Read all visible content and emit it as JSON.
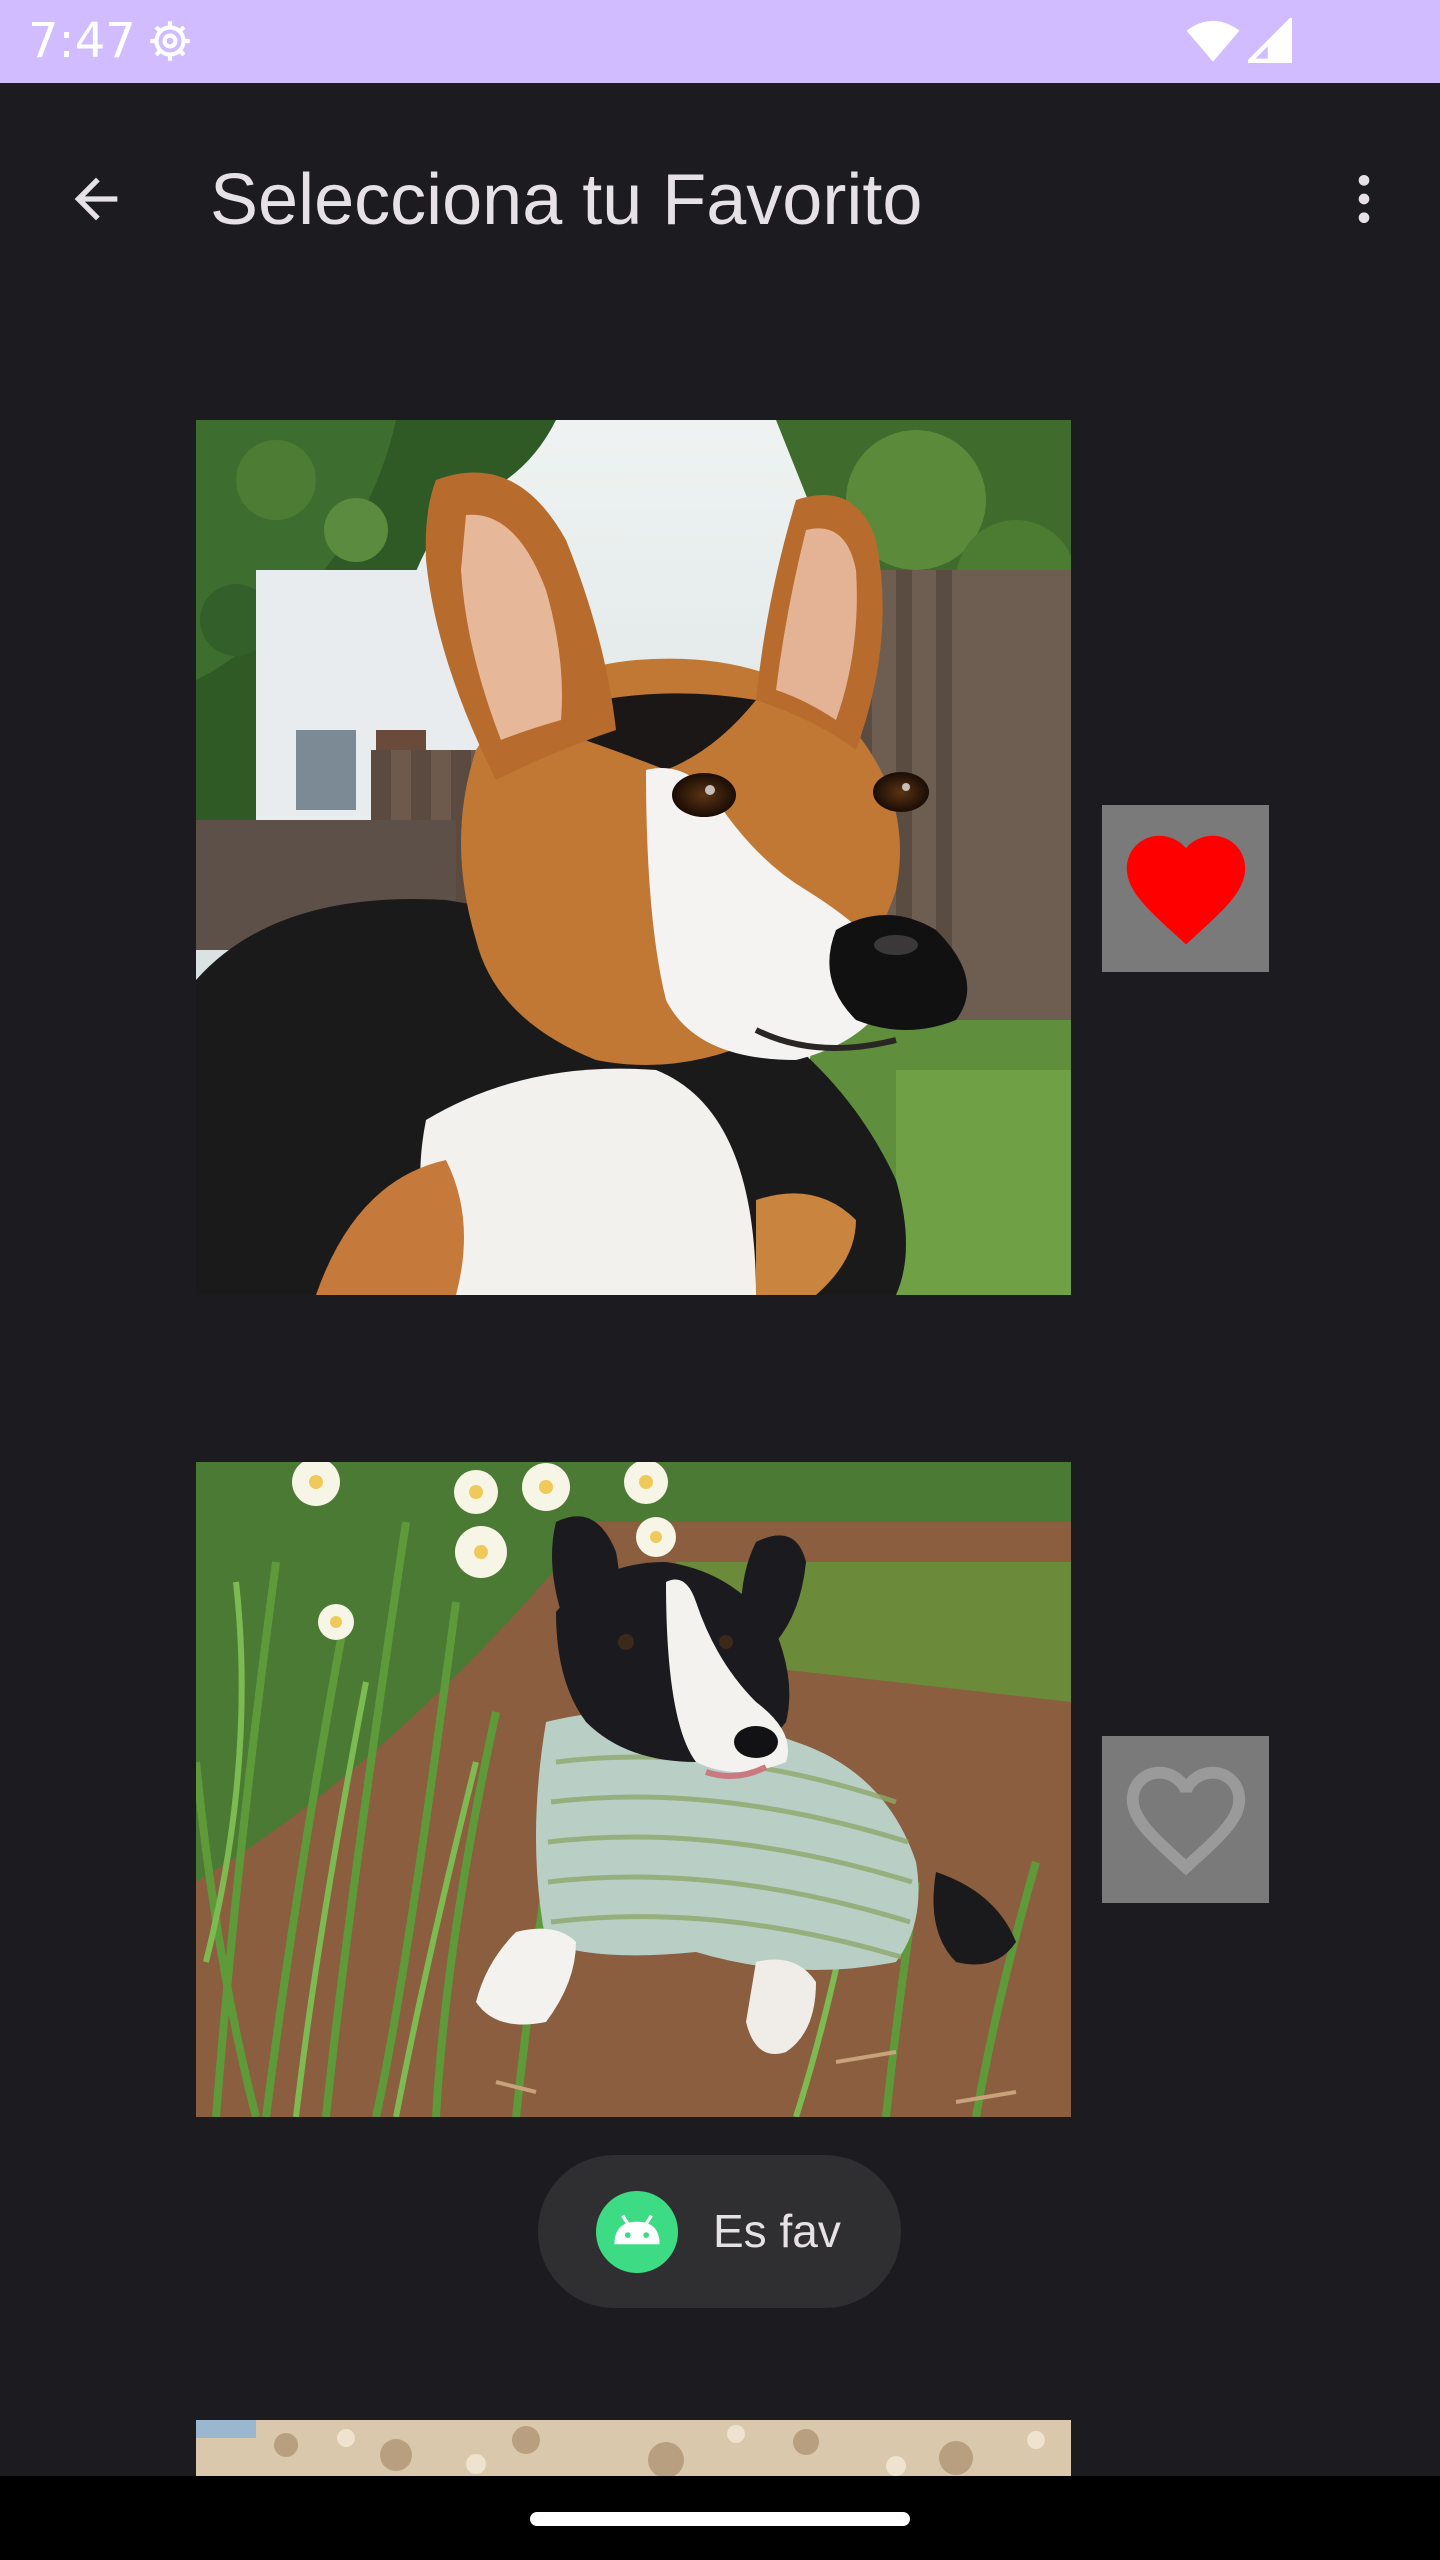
{
  "status_bar": {
    "time": "7:47",
    "background_color": "#d0bcff",
    "icons": [
      "gear-icon",
      "wifi-icon",
      "signal-icon"
    ]
  },
  "app_bar": {
    "title": "Selecciona tu Favorito",
    "back_icon": "arrow-back-icon",
    "menu_icon": "more-vert-icon"
  },
  "items": [
    {
      "photo": "corgi tricolor portrait",
      "favorite": true,
      "heart_color": "#ff0000"
    },
    {
      "photo": "corgi in sweater on grass with daffodils",
      "favorite": false,
      "heart_color": "#9a9a9a"
    },
    {
      "photo": "landscape rocks (partially visible)"
    }
  ],
  "toast": {
    "text": "Es fav",
    "icon": "android-icon"
  },
  "colors": {
    "background": "#1c1b1f",
    "fav_tile": "#7a7a7a",
    "toast_bg": "#2f2f31"
  }
}
